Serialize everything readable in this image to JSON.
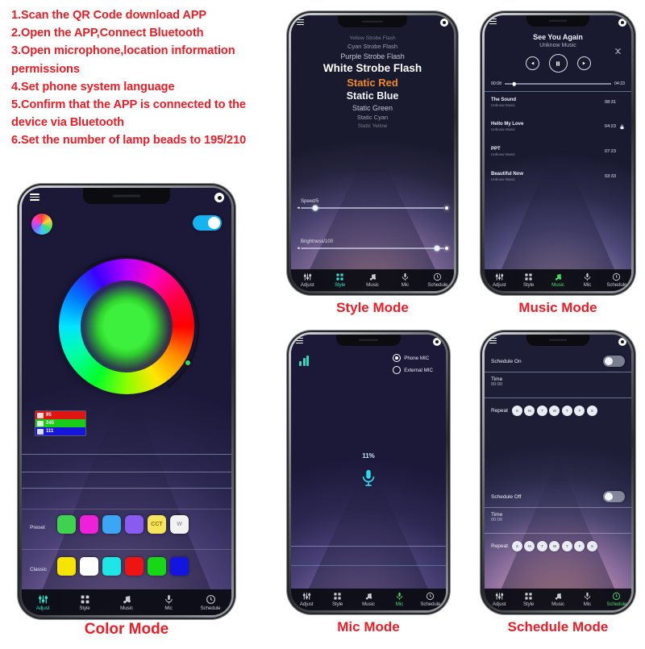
{
  "instructions": [
    "1.Scan the QR Code download APP",
    "2.Open the APP,Connect Bluetooth",
    "3.Open microphone,location information permissions",
    "4.Set phone system language",
    "5.Confirm that the APP is connected to the device via Bluetooth",
    "6.Set the number of lamp beads to 195/210"
  ],
  "captions": {
    "color": "Color Mode",
    "style": "Style Mode",
    "music": "Music Mode",
    "mic": "Mic Mode",
    "schedule": "Schedule Mode"
  },
  "nav": {
    "items": [
      {
        "label": "Adjust",
        "icon": "sliders-icon"
      },
      {
        "label": "Style",
        "icon": "grid-icon"
      },
      {
        "label": "Music",
        "icon": "music-note-icon"
      },
      {
        "label": "Mic",
        "icon": "microphone-icon"
      },
      {
        "label": "Schedule",
        "icon": "clock-icon"
      }
    ]
  },
  "color_mode": {
    "power_on": true,
    "rgb": [
      {
        "channel": "R",
        "value": "95"
      },
      {
        "channel": "G",
        "value": "245"
      },
      {
        "channel": "B",
        "value": "111"
      }
    ],
    "preset_label": "Preset",
    "preset_swatches": [
      {
        "name": "green",
        "color": "#3fd24f",
        "text": ""
      },
      {
        "name": "magenta",
        "color": "#f020d8",
        "text": ""
      },
      {
        "name": "blue",
        "color": "#3aa6f5",
        "text": ""
      },
      {
        "name": "purple",
        "color": "#8a5bf0",
        "text": ""
      },
      {
        "name": "cct",
        "color": "#f5e45c",
        "text": "CCT"
      },
      {
        "name": "white",
        "color": "#f2f2f2",
        "text": "W"
      }
    ],
    "classic_label": "Classic",
    "classic_swatches": [
      {
        "name": "yellow",
        "color": "#f5e400"
      },
      {
        "name": "white",
        "color": "#ffffff"
      },
      {
        "name": "cyan",
        "color": "#1ee6e6"
      },
      {
        "name": "red",
        "color": "#ee1414"
      },
      {
        "name": "green",
        "color": "#16d816"
      },
      {
        "name": "blue",
        "color": "#1414e0"
      }
    ],
    "active_tab": "Adjust"
  },
  "style_mode": {
    "effects": [
      {
        "label": "Yellow Strobe Flash",
        "size": "far"
      },
      {
        "label": "Cyan Strobe Flash",
        "size": "mid"
      },
      {
        "label": "Purple Strobe Flash",
        "size": "near"
      },
      {
        "label": "White Strobe Flash",
        "size": "big"
      },
      {
        "label": "Static Red",
        "size": "sel"
      },
      {
        "label": "Static Blue",
        "size": "big2"
      },
      {
        "label": "Static Green",
        "size": "near"
      },
      {
        "label": "Static Cyan",
        "size": "mid"
      },
      {
        "label": "Static Yellow",
        "size": "far"
      }
    ],
    "selected": "Static Red",
    "speed_label": "Speed/5",
    "speed_value": 8,
    "brightness_label": "Brightness/100",
    "brightness_value": 95,
    "active_tab": "Style"
  },
  "music_mode": {
    "now_playing": {
      "title": "See You Again",
      "artist": "Unknow Music",
      "elapsed": "00:08",
      "duration": "04:23"
    },
    "controls": [
      "prev-icon",
      "pause-icon",
      "next-icon",
      "shuffle-icon"
    ],
    "tracks": [
      {
        "name": "The Sound",
        "artist": "Unknow Music",
        "duration": "08:31",
        "locked": false
      },
      {
        "name": "Hello My Love",
        "artist": "Unknow Music",
        "duration": "04:23",
        "locked": true
      },
      {
        "name": "PPT",
        "artist": "Unknow Music",
        "duration": "07:23",
        "locked": false
      },
      {
        "name": "Beautiful Now",
        "artist": "Unknow Music",
        "duration": "03:33",
        "locked": false
      }
    ],
    "active_tab": "Music"
  },
  "mic_mode": {
    "options": [
      {
        "label": "Phone MIC",
        "selected": true
      },
      {
        "label": "External MIC",
        "selected": false
      }
    ],
    "sensitivity": "11%",
    "active_tab": "Mic"
  },
  "schedule_mode": {
    "on": {
      "label": "Schedule On",
      "enabled": false,
      "time_label": "Time",
      "time_value": "00:00",
      "repeat_label": "Repeat",
      "days": [
        "S",
        "M",
        "T",
        "W",
        "T",
        "F",
        "S"
      ]
    },
    "off": {
      "label": "Schedule Off",
      "enabled": false,
      "time_label": "Time",
      "time_value": "00:00",
      "repeat_label": "Repeat",
      "days": [
        "S",
        "M",
        "T",
        "W",
        "T",
        "F",
        "S"
      ]
    },
    "active_tab": "Schedule"
  }
}
